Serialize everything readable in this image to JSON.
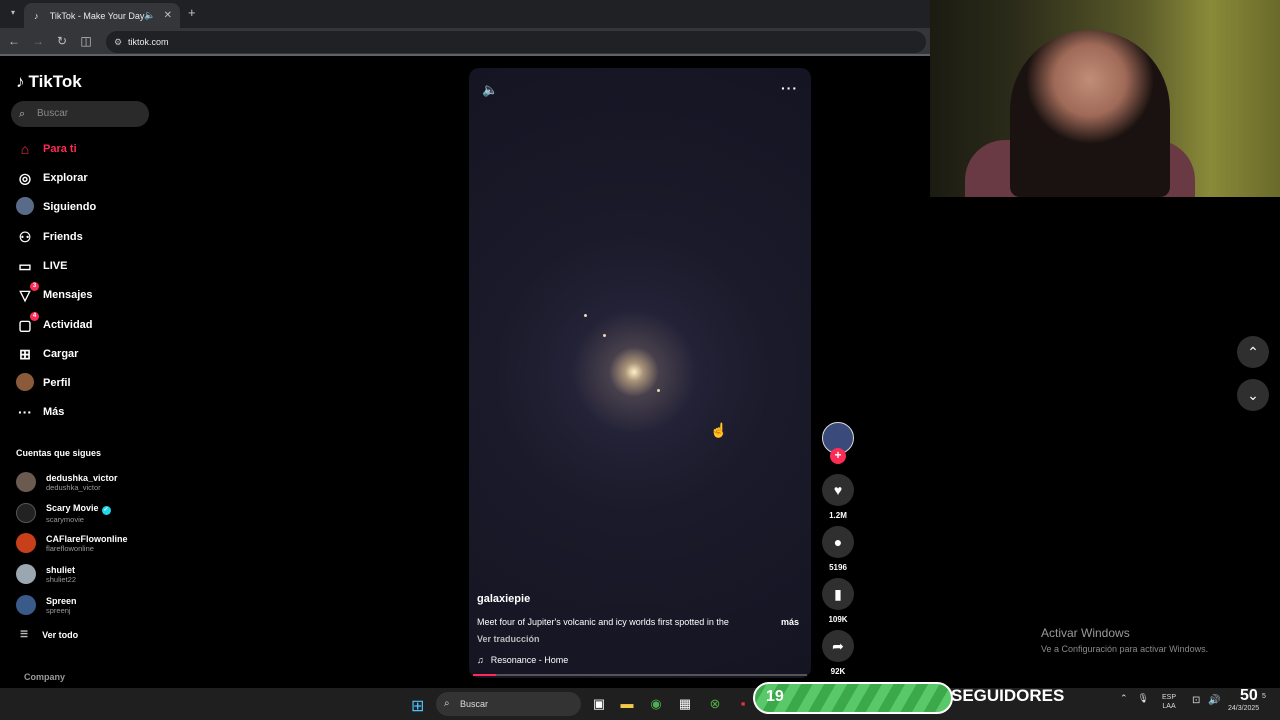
{
  "browser": {
    "tab_title": "TikTok - Make Your Day",
    "url": "tiktok.com"
  },
  "sidebar": {
    "logo": "TikTok",
    "search_placeholder": "Buscar",
    "nav": [
      {
        "label": "Para ti",
        "icon": "home-icon",
        "active": true
      },
      {
        "label": "Explorar",
        "icon": "compass-icon"
      },
      {
        "label": "Siguiendo",
        "icon": "avatar"
      },
      {
        "label": "Friends",
        "icon": "people-icon"
      },
      {
        "label": "LIVE",
        "icon": "tv-icon"
      },
      {
        "label": "Mensajes",
        "icon": "send-icon",
        "badge": "3"
      },
      {
        "label": "Actividad",
        "icon": "inbox-icon",
        "badge": "4"
      },
      {
        "label": "Cargar",
        "icon": "plus-square-icon"
      },
      {
        "label": "Perfil",
        "icon": "avatar"
      },
      {
        "label": "Más",
        "icon": "ellipsis-icon"
      }
    ],
    "following_title": "Cuentas que sigues",
    "accounts": [
      {
        "name": "dedushka_victor",
        "handle": "dedushka_victor"
      },
      {
        "name": "Scary Movie",
        "handle": "scarymovie",
        "verified": true
      },
      {
        "name": "CAFlareFlowonline",
        "handle": "flareflowonline"
      },
      {
        "name": "shuliet",
        "handle": "shuliet22"
      },
      {
        "name": "Spreen",
        "handle": "spreenj"
      }
    ],
    "see_all": "Ver todo",
    "company": "Company"
  },
  "video": {
    "author": "galaxiepie",
    "caption": "Meet four of Jupiter's volcanic and icy worlds first spotted in the",
    "more": "más",
    "translate": "Ver traducción",
    "music": "Resonance - Home",
    "progress": 0.07
  },
  "actions": {
    "likes": "1.2M",
    "comments": "5196",
    "saves": "109K",
    "shares": "92K"
  },
  "watermark": {
    "line1": "Activar Windows",
    "line2": "Ve a Configuración para activar Windows."
  },
  "taskbar": {
    "search": "Buscar",
    "followers_count": "19",
    "followers_label": "SEGUIDORES",
    "lang_top": "ESP",
    "lang_bottom": "LAA",
    "clock": "50",
    "clock_sec": "5",
    "date": "24/3/2025"
  }
}
